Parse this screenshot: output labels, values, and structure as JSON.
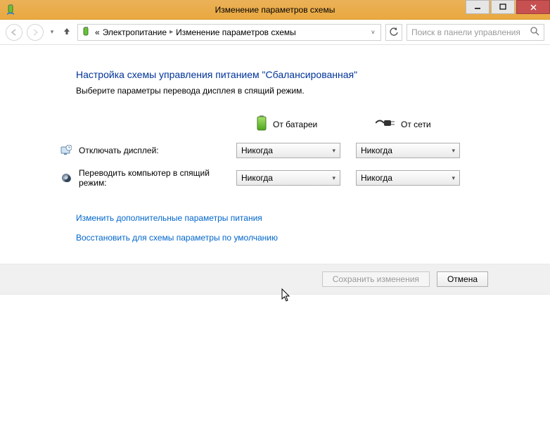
{
  "window": {
    "title": "Изменение параметров схемы"
  },
  "breadcrumb": {
    "level1": "Электропитание",
    "level2": "Изменение параметров схемы"
  },
  "search": {
    "placeholder": "Поиск в панели управления"
  },
  "page": {
    "heading": "Настройка схемы управления питанием \"Сбалансированная\"",
    "subheading": "Выберите параметры перевода дисплея в спящий режим."
  },
  "columns": {
    "battery": "От батареи",
    "plugged": "От сети"
  },
  "rows": {
    "display_off": {
      "label": "Отключать дисплей:",
      "battery_value": "Никогда",
      "plugged_value": "Никогда"
    },
    "sleep": {
      "label": "Переводить компьютер в спящий режим:",
      "battery_value": "Никогда",
      "plugged_value": "Никогда"
    }
  },
  "links": {
    "advanced": "Изменить дополнительные параметры питания",
    "restore": "Восстановить для схемы параметры по умолчанию"
  },
  "buttons": {
    "save": "Сохранить изменения",
    "cancel": "Отмена"
  }
}
